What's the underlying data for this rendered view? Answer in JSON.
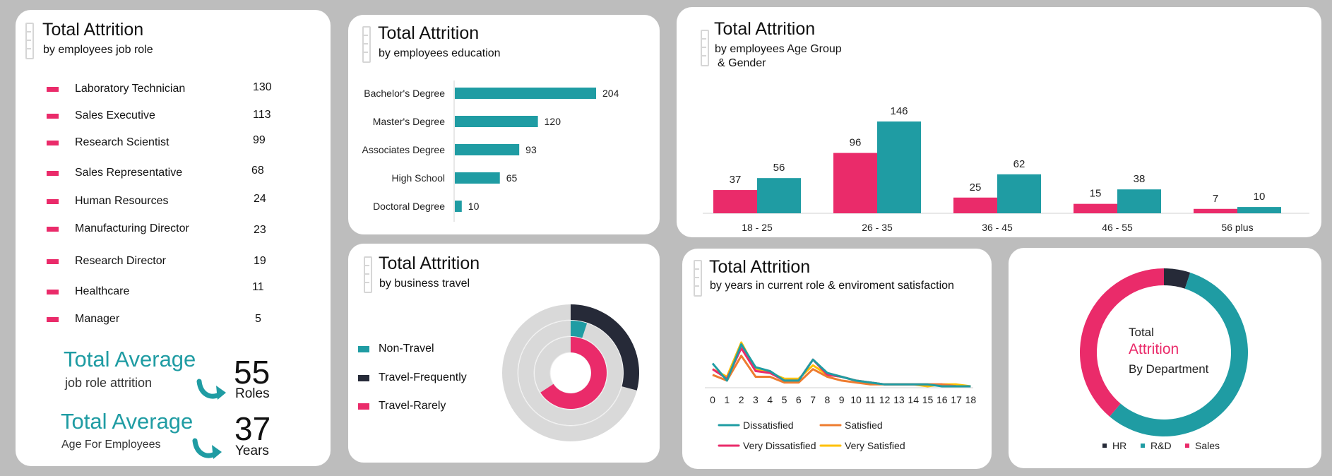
{
  "colors": {
    "teal": "#1f9ca3",
    "pink": "#ea2b6a",
    "dark": "#262a38",
    "orange": "#ee7c2f",
    "yellow": "#ffc000",
    "ring_bg": "#d9d9d9"
  },
  "job_role": {
    "title": "Total Attrition",
    "subtitle": "by employees job role",
    "items": [
      {
        "label": "Laboratory Technician",
        "value": "130"
      },
      {
        "label": "Sales Executive",
        "value": "113"
      },
      {
        "label": "Research Scientist",
        "value": "99"
      },
      {
        "label": "Sales Representative",
        "value": "68"
      },
      {
        "label": "Human Resources",
        "value": "24"
      },
      {
        "label": "Manufacturing Director",
        "value": "23"
      },
      {
        "label": "Research Director",
        "value": "19"
      },
      {
        "label": "Healthcare",
        "value": "11"
      },
      {
        "label": "Manager",
        "value": "5"
      }
    ],
    "kpi1": {
      "title": "Total Average",
      "subtitle": "job role attrition",
      "value": "55",
      "unit": "Roles"
    },
    "kpi2": {
      "title": "Total Average",
      "subtitle": "Age For Employees",
      "value": "37",
      "unit": "Years"
    }
  },
  "education": {
    "title": "Total Attrition",
    "subtitle": "by employees education"
  },
  "age_gender": {
    "title": "Total Attrition",
    "subtitle_line1": "by employees Age Group",
    "subtitle_line2": "& Gender"
  },
  "travel": {
    "title": "Total Attrition",
    "subtitle": "by business travel",
    "legend": [
      "Non-Travel",
      "Travel-Frequently",
      "Travel-Rarely"
    ]
  },
  "years_role": {
    "title": "Total Attrition",
    "subtitle": "by years in current role & enviroment satisfaction"
  },
  "department": {
    "center_line1": "Total",
    "center_line2": "Attrition",
    "center_line3": "By Department",
    "legend": [
      "HR",
      "R&D",
      "Sales"
    ]
  },
  "chart_data": [
    {
      "type": "bar",
      "orientation": "horizontal",
      "title": "Total Attrition",
      "subtitle": "by employees education",
      "categories": [
        "Bachelor's Degree",
        "Master's Degree",
        "Associates Degree",
        "High School",
        "Doctoral Degree"
      ],
      "values": [
        204,
        120,
        93,
        65,
        10
      ],
      "grid": false
    },
    {
      "type": "bar",
      "title": "Total Attrition",
      "subtitle": "by employees Age Group & Gender",
      "categories": [
        "18 - 25",
        "26 - 35",
        "36 - 45",
        "46 - 55",
        "56 plus"
      ],
      "series": [
        {
          "color": "#ea2b6a",
          "values": [
            37,
            96,
            25,
            15,
            7
          ]
        },
        {
          "color": "#1f9ca3",
          "values": [
            56,
            146,
            62,
            38,
            10
          ]
        }
      ],
      "ylim": [
        0,
        150
      ],
      "grid": false
    },
    {
      "type": "pie",
      "style": "nested-donut",
      "title": "Total Attrition",
      "subtitle": "by business travel",
      "series": [
        {
          "name": "Travel-Frequently",
          "color": "#262a38",
          "value": 69
        },
        {
          "name": "Non-Travel",
          "color": "#1f9ca3",
          "value": 12
        },
        {
          "name": "Travel-Rarely",
          "color": "#ea2b6a",
          "value": 156
        }
      ],
      "legend": "left"
    },
    {
      "type": "line",
      "title": "Total Attrition",
      "subtitle": "by years in current role & enviroment satisfaction",
      "x": [
        0,
        1,
        2,
        3,
        4,
        5,
        6,
        7,
        8,
        9,
        10,
        11,
        12,
        13,
        14,
        15,
        16,
        17,
        18
      ],
      "series": [
        {
          "name": "Dissatisfied",
          "color": "#1f9ca3",
          "values": [
            12,
            3,
            22,
            10,
            8,
            3,
            3,
            14,
            7,
            5,
            3,
            2,
            1,
            1,
            1,
            1,
            0,
            0,
            0
          ]
        },
        {
          "name": "Satisfied",
          "color": "#ee7c2f",
          "values": [
            6,
            3,
            16,
            5,
            5,
            2,
            2,
            9,
            5,
            3,
            2,
            1,
            1,
            1,
            1,
            1,
            1,
            0,
            0
          ]
        },
        {
          "name": "Very Dissatisfied",
          "color": "#ea2b6a",
          "values": [
            9,
            4,
            20,
            8,
            7,
            3,
            3,
            14,
            6,
            5,
            3,
            2,
            1,
            1,
            1,
            1,
            1,
            0,
            0
          ]
        },
        {
          "name": "Very Satisfied",
          "color": "#ffc000",
          "values": [
            9,
            5,
            23,
            9,
            7,
            4,
            4,
            11,
            6,
            5,
            3,
            2,
            1,
            1,
            1,
            0,
            1,
            1,
            0
          ]
        }
      ],
      "legend": "bottom",
      "grid": false
    },
    {
      "type": "pie",
      "style": "donut",
      "title": "Total Attrition By Department",
      "series": [
        {
          "name": "HR",
          "color": "#262a38",
          "value": 12
        },
        {
          "name": "R&D",
          "color": "#1f9ca3",
          "value": 133
        },
        {
          "name": "Sales",
          "color": "#ea2b6a",
          "value": 92
        }
      ],
      "legend": "bottom"
    }
  ]
}
